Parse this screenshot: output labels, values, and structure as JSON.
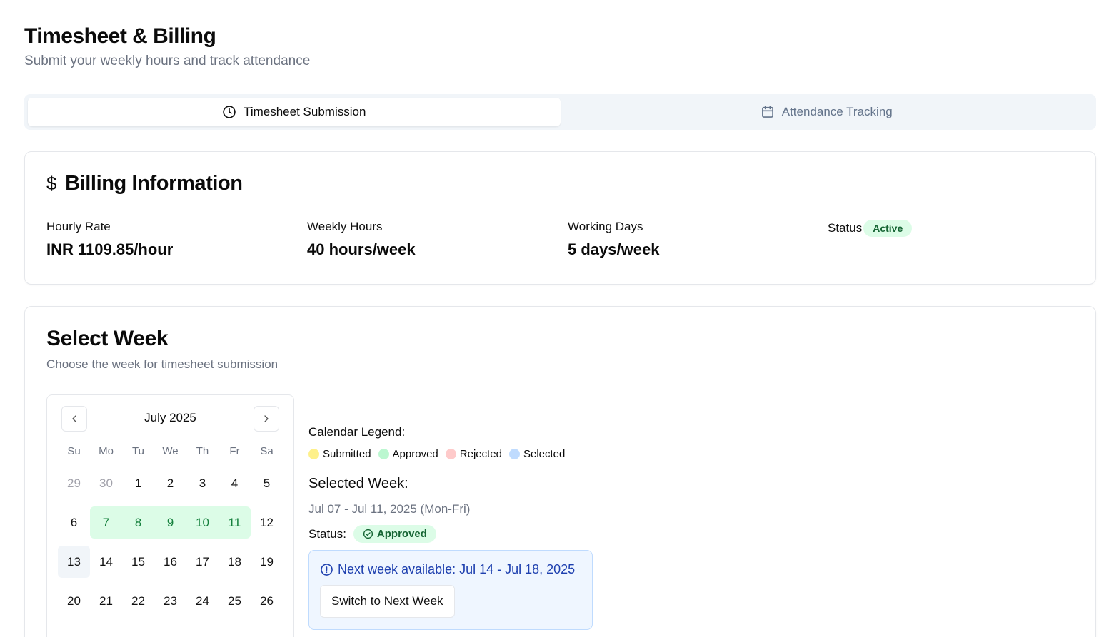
{
  "header": {
    "title": "Timesheet & Billing",
    "subtitle": "Submit your weekly hours and track attendance"
  },
  "tabs": [
    {
      "label": "Timesheet Submission",
      "icon": "clock-icon",
      "active": true
    },
    {
      "label": "Attendance Tracking",
      "icon": "calendar-icon",
      "active": false
    }
  ],
  "billing": {
    "title": "Billing Information",
    "icon": "dollar-icon",
    "hourly_rate": {
      "label": "Hourly Rate",
      "value": "INR 1109.85/hour"
    },
    "weekly_hours": {
      "label": "Weekly Hours",
      "value": "40 hours/week"
    },
    "working_days": {
      "label": "Working Days",
      "value": "5 days/week"
    },
    "status": {
      "label": "Status",
      "value": "Active"
    }
  },
  "week": {
    "title": "Select Week",
    "subtitle": "Choose the week for timesheet submission",
    "calendar": {
      "month": "July 2025",
      "weekdays": [
        "Su",
        "Mo",
        "Tu",
        "We",
        "Th",
        "Fr",
        "Sa"
      ],
      "rows": [
        [
          "29",
          "30",
          "1",
          "2",
          "3",
          "4",
          "5"
        ],
        [
          "6",
          "7",
          "8",
          "9",
          "10",
          "11",
          "12"
        ],
        [
          "13",
          "14",
          "15",
          "16",
          "17",
          "18",
          "19"
        ],
        [
          "20",
          "21",
          "22",
          "23",
          "24",
          "25",
          "26"
        ]
      ],
      "outside_days": [
        "29",
        "30"
      ],
      "approved_days": [
        "7",
        "8",
        "9",
        "10",
        "11"
      ],
      "today": "13"
    },
    "legend": {
      "title": "Calendar Legend:",
      "items": [
        {
          "label": "Submitted",
          "color": "#fef08a"
        },
        {
          "label": "Approved",
          "color": "#bbf7d0"
        },
        {
          "label": "Rejected",
          "color": "#fecaca"
        },
        {
          "label": "Selected",
          "color": "#bfdbfe"
        }
      ]
    },
    "selected": {
      "title": "Selected Week:",
      "range": "Jul 07 - Jul 11, 2025 (Mon-Fri)",
      "status_label": "Status:",
      "status_value": "Approved"
    },
    "next": {
      "text": "Next week available: Jul 14 - Jul 18, 2025",
      "button": "Switch to Next Week"
    }
  }
}
